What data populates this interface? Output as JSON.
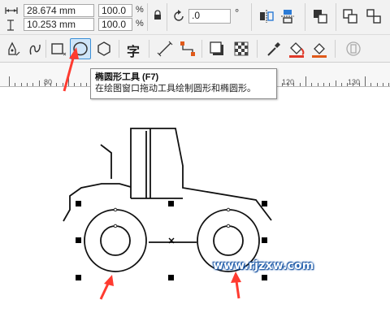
{
  "property_bar": {
    "width_value": "28.674 mm",
    "height_value": "10.253 mm",
    "scale_x": "100.0",
    "scale_y": "100.0",
    "percent_unit": "%",
    "rotation_value": ".0",
    "degree_unit": "°"
  },
  "tooltip": {
    "title": "椭圆形工具 (F7)",
    "description": "在绘图窗口拖动工具绘制圆形和椭圆形。"
  },
  "ruler": {
    "labels": [
      "80",
      "120",
      "130"
    ]
  },
  "watermark": {
    "text": "www.rjzxw.com"
  },
  "colors": {
    "accent_arrow": "#ff3b30",
    "active_tool_bg": "#cfe5f8",
    "active_tool_border": "#3b8fd6",
    "watermark_fill": "#ffffff",
    "watermark_outline": "#1a5fb4"
  },
  "toolbar": {
    "icons": [
      "freehand-icon",
      "bezier-icon",
      "rectangle-icon",
      "ellipse-icon",
      "polygon-icon",
      "text-icon",
      "dimension-icon",
      "connector-icon",
      "drop-shadow-icon",
      "transparency-icon",
      "eyedropper-icon",
      "fill-icon",
      "smart-fill-icon",
      "outline-icon"
    ],
    "text_tool_glyph": "字"
  }
}
